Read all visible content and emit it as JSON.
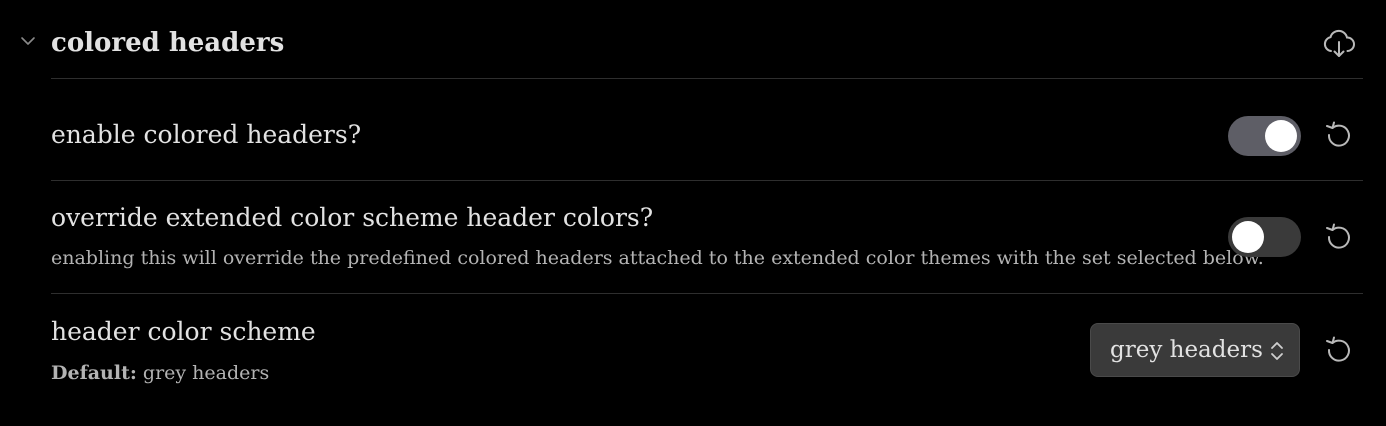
{
  "section": {
    "title": "colored headers",
    "collapse_icon": "chevron-down-icon",
    "action_icon": "cloud-download-icon"
  },
  "settings": [
    {
      "name": "enable colored headers?",
      "control": "toggle",
      "toggle_on": true,
      "reset_icon": "reset-icon"
    },
    {
      "name": "override extended color scheme header colors?",
      "description": "enabling this will override the predefined colored headers attached to the extended color themes with the set selected below.",
      "control": "toggle",
      "toggle_on": false,
      "reset_icon": "reset-icon"
    },
    {
      "name": "header color scheme",
      "default_label": "Default:",
      "default_value": "grey headers",
      "control": "dropdown",
      "selected": "grey headers",
      "dropdown_icon": "chevrons-up-down-icon",
      "reset_icon": "reset-icon"
    }
  ],
  "colors": {
    "background": "#000000",
    "text": "#e2e2e2",
    "muted_text": "#b3b3b3",
    "divider": "#2e2e2e",
    "toggle_on": "#5e5e66",
    "toggle_off": "#3a3a3a",
    "dropdown_bg": "#3a3a3a"
  }
}
